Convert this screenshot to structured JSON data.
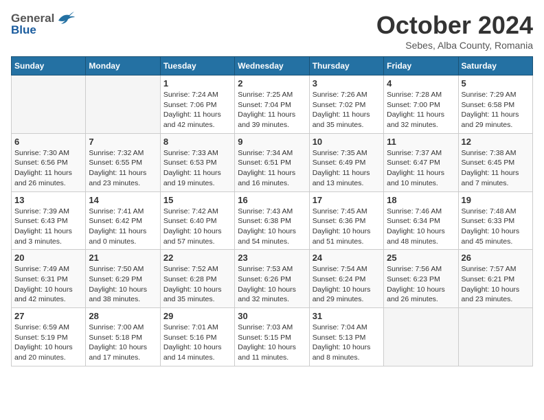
{
  "header": {
    "logo_general": "General",
    "logo_blue": "Blue",
    "month_title": "October 2024",
    "location": "Sebes, Alba County, Romania"
  },
  "days_of_week": [
    "Sunday",
    "Monday",
    "Tuesday",
    "Wednesday",
    "Thursday",
    "Friday",
    "Saturday"
  ],
  "weeks": [
    [
      {
        "num": "",
        "info": ""
      },
      {
        "num": "",
        "info": ""
      },
      {
        "num": "1",
        "info": "Sunrise: 7:24 AM\nSunset: 7:06 PM\nDaylight: 11 hours and 42 minutes."
      },
      {
        "num": "2",
        "info": "Sunrise: 7:25 AM\nSunset: 7:04 PM\nDaylight: 11 hours and 39 minutes."
      },
      {
        "num": "3",
        "info": "Sunrise: 7:26 AM\nSunset: 7:02 PM\nDaylight: 11 hours and 35 minutes."
      },
      {
        "num": "4",
        "info": "Sunrise: 7:28 AM\nSunset: 7:00 PM\nDaylight: 11 hours and 32 minutes."
      },
      {
        "num": "5",
        "info": "Sunrise: 7:29 AM\nSunset: 6:58 PM\nDaylight: 11 hours and 29 minutes."
      }
    ],
    [
      {
        "num": "6",
        "info": "Sunrise: 7:30 AM\nSunset: 6:56 PM\nDaylight: 11 hours and 26 minutes."
      },
      {
        "num": "7",
        "info": "Sunrise: 7:32 AM\nSunset: 6:55 PM\nDaylight: 11 hours and 23 minutes."
      },
      {
        "num": "8",
        "info": "Sunrise: 7:33 AM\nSunset: 6:53 PM\nDaylight: 11 hours and 19 minutes."
      },
      {
        "num": "9",
        "info": "Sunrise: 7:34 AM\nSunset: 6:51 PM\nDaylight: 11 hours and 16 minutes."
      },
      {
        "num": "10",
        "info": "Sunrise: 7:35 AM\nSunset: 6:49 PM\nDaylight: 11 hours and 13 minutes."
      },
      {
        "num": "11",
        "info": "Sunrise: 7:37 AM\nSunset: 6:47 PM\nDaylight: 11 hours and 10 minutes."
      },
      {
        "num": "12",
        "info": "Sunrise: 7:38 AM\nSunset: 6:45 PM\nDaylight: 11 hours and 7 minutes."
      }
    ],
    [
      {
        "num": "13",
        "info": "Sunrise: 7:39 AM\nSunset: 6:43 PM\nDaylight: 11 hours and 3 minutes."
      },
      {
        "num": "14",
        "info": "Sunrise: 7:41 AM\nSunset: 6:42 PM\nDaylight: 11 hours and 0 minutes."
      },
      {
        "num": "15",
        "info": "Sunrise: 7:42 AM\nSunset: 6:40 PM\nDaylight: 10 hours and 57 minutes."
      },
      {
        "num": "16",
        "info": "Sunrise: 7:43 AM\nSunset: 6:38 PM\nDaylight: 10 hours and 54 minutes."
      },
      {
        "num": "17",
        "info": "Sunrise: 7:45 AM\nSunset: 6:36 PM\nDaylight: 10 hours and 51 minutes."
      },
      {
        "num": "18",
        "info": "Sunrise: 7:46 AM\nSunset: 6:34 PM\nDaylight: 10 hours and 48 minutes."
      },
      {
        "num": "19",
        "info": "Sunrise: 7:48 AM\nSunset: 6:33 PM\nDaylight: 10 hours and 45 minutes."
      }
    ],
    [
      {
        "num": "20",
        "info": "Sunrise: 7:49 AM\nSunset: 6:31 PM\nDaylight: 10 hours and 42 minutes."
      },
      {
        "num": "21",
        "info": "Sunrise: 7:50 AM\nSunset: 6:29 PM\nDaylight: 10 hours and 38 minutes."
      },
      {
        "num": "22",
        "info": "Sunrise: 7:52 AM\nSunset: 6:28 PM\nDaylight: 10 hours and 35 minutes."
      },
      {
        "num": "23",
        "info": "Sunrise: 7:53 AM\nSunset: 6:26 PM\nDaylight: 10 hours and 32 minutes."
      },
      {
        "num": "24",
        "info": "Sunrise: 7:54 AM\nSunset: 6:24 PM\nDaylight: 10 hours and 29 minutes."
      },
      {
        "num": "25",
        "info": "Sunrise: 7:56 AM\nSunset: 6:23 PM\nDaylight: 10 hours and 26 minutes."
      },
      {
        "num": "26",
        "info": "Sunrise: 7:57 AM\nSunset: 6:21 PM\nDaylight: 10 hours and 23 minutes."
      }
    ],
    [
      {
        "num": "27",
        "info": "Sunrise: 6:59 AM\nSunset: 5:19 PM\nDaylight: 10 hours and 20 minutes."
      },
      {
        "num": "28",
        "info": "Sunrise: 7:00 AM\nSunset: 5:18 PM\nDaylight: 10 hours and 17 minutes."
      },
      {
        "num": "29",
        "info": "Sunrise: 7:01 AM\nSunset: 5:16 PM\nDaylight: 10 hours and 14 minutes."
      },
      {
        "num": "30",
        "info": "Sunrise: 7:03 AM\nSunset: 5:15 PM\nDaylight: 10 hours and 11 minutes."
      },
      {
        "num": "31",
        "info": "Sunrise: 7:04 AM\nSunset: 5:13 PM\nDaylight: 10 hours and 8 minutes."
      },
      {
        "num": "",
        "info": ""
      },
      {
        "num": "",
        "info": ""
      }
    ]
  ]
}
